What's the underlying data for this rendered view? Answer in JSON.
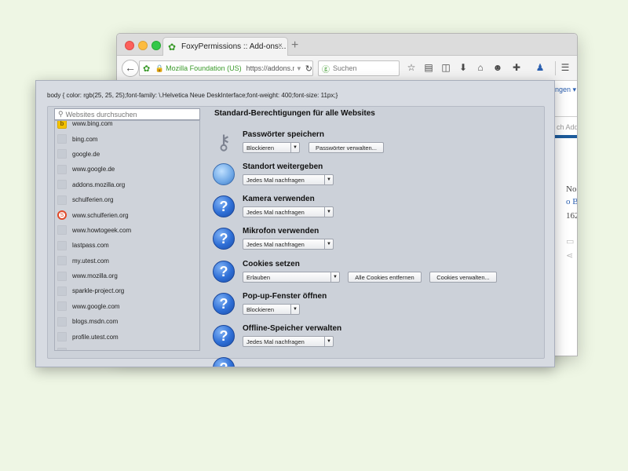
{
  "browser": {
    "tab_title": "FoxyPermissions :: Add-ons…",
    "tab_close": "×",
    "new_tab": "+",
    "url_identity": "Mozilla Foundation (US)",
    "url_text": "https://addons.m",
    "search_placeholder": "Suchen",
    "page": {
      "menu_text": "ngen ▾",
      "search_text": "ch Add",
      "line1": "No",
      "line2": "o B",
      "line3": "162"
    }
  },
  "panel": {
    "css_debug": "body { color: rgb(25, 25, 25);font-family: \\.Helvetica Neue DeskInterface;font-weight: 400;font-size: 11px;}",
    "site_search_placeholder": "Websites durchsuchen",
    "sites": [
      {
        "domain": "www.bing.com",
        "icon": "bing-icon"
      },
      {
        "domain": "bing.com",
        "icon": "blank"
      },
      {
        "domain": "google.de",
        "icon": "blank"
      },
      {
        "domain": "www.google.de",
        "icon": "blank"
      },
      {
        "domain": "addons.mozilla.org",
        "icon": "blank"
      },
      {
        "domain": "schulferien.org",
        "icon": "blank"
      },
      {
        "domain": "www.schulferien.org",
        "icon": "schulferien-icon"
      },
      {
        "domain": "www.howtogeek.com",
        "icon": "blank"
      },
      {
        "domain": "lastpass.com",
        "icon": "blank"
      },
      {
        "domain": "my.utest.com",
        "icon": "blank"
      },
      {
        "domain": "www.mozilla.org",
        "icon": "blank"
      },
      {
        "domain": "sparkle-project.org",
        "icon": "blank"
      },
      {
        "domain": "www.google.com",
        "icon": "blank"
      },
      {
        "domain": "blogs.msdn.com",
        "icon": "blank"
      },
      {
        "domain": "profile.utest.com",
        "icon": "blank"
      },
      {
        "domain": "",
        "icon": "blank"
      }
    ],
    "title": "Standard-Berechtigungen für alle Websites",
    "permissions": [
      {
        "label": "Passwörter speichern",
        "icon": "key-icon",
        "value": "Blockieren",
        "buttons": [
          "Passwörter verwalten..."
        ]
      },
      {
        "label": "Standort weitergeben",
        "icon": "location-icon",
        "value": "Jedes Mal nachfragen",
        "buttons": []
      },
      {
        "label": "Kamera verwenden",
        "icon": "help-icon",
        "value": "Jedes Mal nachfragen",
        "buttons": []
      },
      {
        "label": "Mikrofon verwenden",
        "icon": "help-icon",
        "value": "Jedes Mal nachfragen",
        "buttons": []
      },
      {
        "label": "Cookies setzen",
        "icon": "help-icon",
        "value": "Erlauben",
        "buttons": [
          "Alle Cookies entfernen",
          "Cookies verwalten..."
        ]
      },
      {
        "label": "Pop-up-Fenster öffnen",
        "icon": "help-icon",
        "value": "Blockieren",
        "buttons": []
      },
      {
        "label": "Offline-Speicher verwalten",
        "icon": "help-icon",
        "value": "Jedes Mal nachfragen",
        "buttons": []
      }
    ]
  }
}
